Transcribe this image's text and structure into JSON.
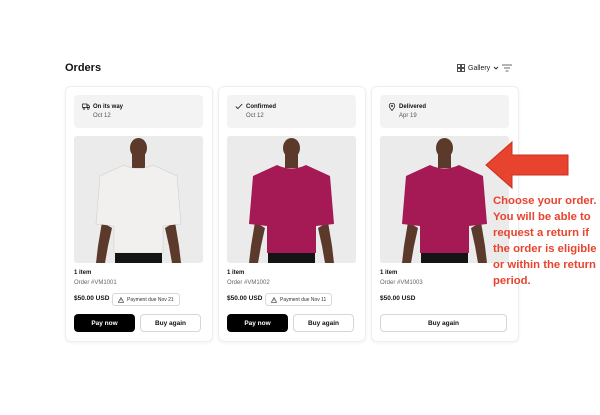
{
  "header": {
    "title": "Orders",
    "view_label": "Gallery",
    "view_icon": "gallery-grid-icon",
    "filter_icon": "filter-icon"
  },
  "orders": [
    {
      "status": "On its way",
      "status_icon": "truck-icon",
      "date": "Oct 12",
      "shirt_color": "#f1f0ee",
      "item_count": "1 item",
      "order_number": "Order #VM1001",
      "price": "$50.00 USD",
      "payment_due": "Payment due Nov 21",
      "pay_label": "Pay now",
      "buy_label": "Buy again"
    },
    {
      "status": "Confirmed",
      "status_icon": "checkmark-icon",
      "date": "Oct 12",
      "shirt_color": "#a51a55",
      "item_count": "1 item",
      "order_number": "Order #VM1002",
      "price": "$50.00 USD",
      "payment_due": "Payment due Nov 11",
      "pay_label": "Pay now",
      "buy_label": "Buy again"
    },
    {
      "status": "Delivered",
      "status_icon": "location-pin-icon",
      "date": "Apr 19",
      "shirt_color": "#a51a55",
      "item_count": "1 item",
      "order_number": "Order #VM1003",
      "price": "$50.00 USD",
      "buy_label": "Buy again"
    }
  ],
  "callout": {
    "text": "Choose your order. You will be able to request a return if the order is eligible or within the return period.",
    "color": "#e8432e"
  }
}
